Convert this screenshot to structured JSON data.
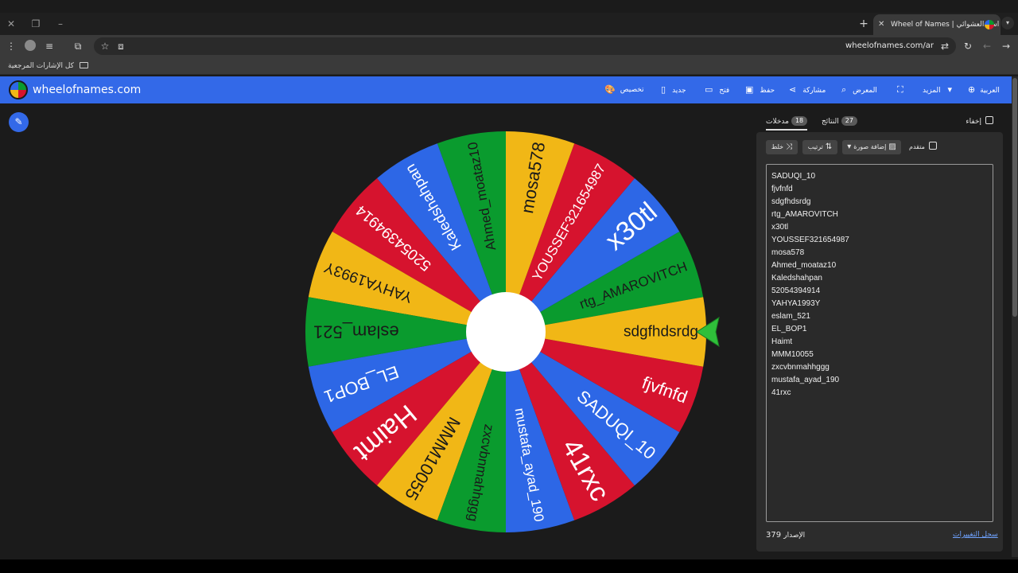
{
  "browser": {
    "tab_title": "Wheel of Names | اسم العشوائي",
    "url": "wheelofnames.com/ar",
    "bookmarks_label": "كل الإشارات المرجعية"
  },
  "app": {
    "brand": "wheelofnames.com",
    "nav": {
      "customize": "تخصيص",
      "new": "جديد",
      "open": "فتح",
      "save": "حفظ",
      "share": "مشاركة",
      "gallery": "المعرض",
      "more": "المزيد",
      "language": "العربية"
    },
    "colors": {
      "header": "#3369e8",
      "green": "#0a9b2e",
      "red": "#d6132e",
      "yellow": "#f1b716",
      "blue": "#2d67e6"
    }
  },
  "panel": {
    "tab_entries_label": "مدخلات",
    "tab_entries_count": "18",
    "tab_results_label": "النتائج",
    "tab_results_count": "27",
    "hide_label": "إخفاء",
    "shuffle_label": "خلط",
    "sort_label": "ترتيب",
    "add_image_label": "إضافة صورة",
    "advanced_label": "متقدم",
    "version_label": "الإصدار",
    "version_number": "379",
    "changelog_label": "سجل التغييرات",
    "entries": [
      "SADUQI_10",
      "fjvfnfd",
      "sdgfhdsrdg",
      "rtg_AMAROVITCH",
      "x30tl",
      "YOUSSEF321654987",
      "mosa578",
      "Ahmed_moataz10",
      "Kaledshahpan",
      "52054394914",
      "YAHYA1993Y",
      "eslam_521",
      "EL_BOP1",
      "Haimt",
      "MMM10055",
      "zxcvbnmahhggg",
      "mustafa_ayad_190",
      "41rxc"
    ]
  },
  "wheel": {
    "segments": [
      {
        "label": "rtg_AMAROVITCH",
        "color": "#0a9b2e"
      },
      {
        "label": "x30tl",
        "color": "#2d67e6"
      },
      {
        "label": "YOUSSEF321654987",
        "color": "#d6132e"
      },
      {
        "label": "mosa578",
        "color": "#f1b716"
      },
      {
        "label": "Ahmed_moataz10",
        "color": "#0a9b2e"
      },
      {
        "label": "Kaledshahpan",
        "color": "#2d67e6"
      },
      {
        "label": "52054394914",
        "color": "#d6132e"
      },
      {
        "label": "YAHYA1993Y",
        "color": "#f1b716"
      },
      {
        "label": "eslam_521",
        "color": "#0a9b2e"
      },
      {
        "label": "EL_BOP1",
        "color": "#2d67e6"
      },
      {
        "label": "Haimt",
        "color": "#d6132e"
      },
      {
        "label": "MMM10055",
        "color": "#f1b716"
      },
      {
        "label": "zxcvbnmahhggg",
        "color": "#0a9b2e"
      },
      {
        "label": "mustafa_ayad_190",
        "color": "#2d67e6"
      },
      {
        "label": "41rxc",
        "color": "#d6132e"
      },
      {
        "label": "SADUQI_10",
        "color": "#2d67e6"
      },
      {
        "label": "fjvfnfd",
        "color": "#d6132e"
      },
      {
        "label": "sdgfhdsrdg",
        "color": "#f1b716"
      }
    ]
  }
}
